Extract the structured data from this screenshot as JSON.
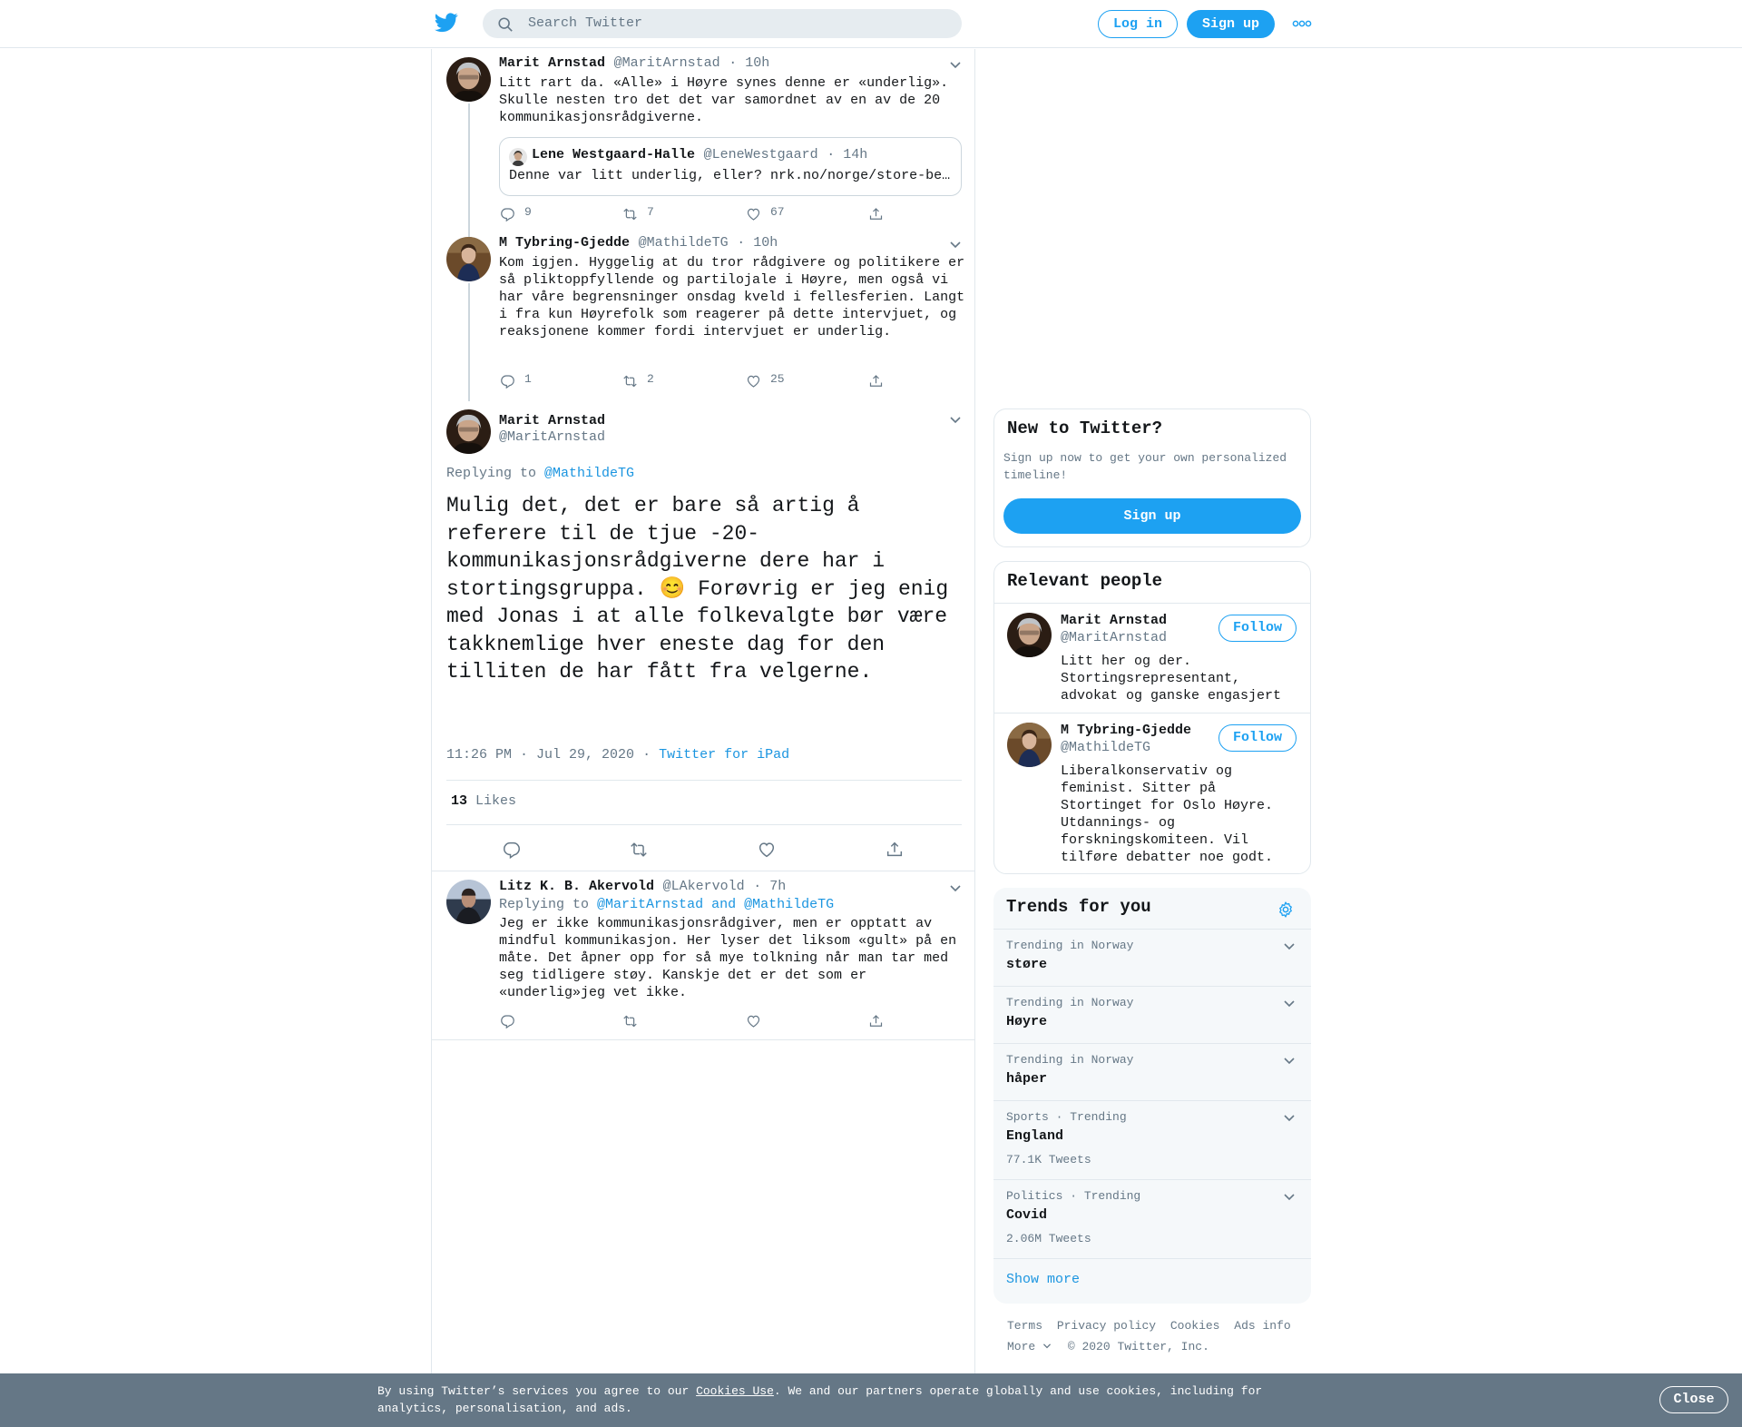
{
  "nav": {
    "search_placeholder": "Search Twitter",
    "login_label": "Log in",
    "signup_label": "Sign up",
    "icons": [
      "twitter-bird-icon",
      "search-icon",
      "more-icon"
    ],
    "accent_color": "#1da1f2"
  },
  "thread": [
    {
      "name": "Marit Arnstad",
      "handle": "@MaritArnstad",
      "time": "· 10h",
      "text": "Litt rart da. «Alle» i Høyre synes denne er «underlig». Skulle nesten tro det det var samordnet av en av de 20 kommunikasjonsrådgiverne.",
      "quote": {
        "name": "Lene Westgaard-Halle",
        "handle": "@LeneWestgaard",
        "time": "· 14h",
        "text": "Denne var litt underlig, eller? nrk.no/norge/store-be…"
      },
      "replies": "9",
      "retweets": "7",
      "likes": "67"
    },
    {
      "name": "M Tybring-Gjedde",
      "handle": "@MathildeTG",
      "time": "· 10h",
      "text": "Kom igjen. Hyggelig at du tror rådgivere og politikere er så pliktoppfyllende og partilojale i Høyre, men også vi har våre begrensninger onsdag kveld i fellesferien. Langt i fra kun Høyrefolk som reagerer på dette intervjuet, og reaksjonene kommer fordi intervjuet er underlig.",
      "replies": "1",
      "retweets": "2",
      "likes": "25"
    }
  ],
  "focused": {
    "name": "Marit Arnstad",
    "handle": "@MaritArnstad",
    "replying_prefix": "Replying to",
    "replying_to": "@MathildeTG",
    "text_part1": "Mulig det, det er bare så artig å referere til de tjue -20-kommunikasjonsrådgiverne dere har i stortingsgruppa.",
    "emoji": "😊",
    "text_part2": "Forøvrig er jeg enig med Jonas i at alle folkevalgte bør være takknemlige hver eneste dag for den tilliten de har fått fra velgerne.",
    "timestamp": "11:26 PM · Jul 29, 2020",
    "sep": "·",
    "source": "Twitter for iPad",
    "likes_count": "13",
    "likes_label": "Likes"
  },
  "reply": {
    "name": "Litz K. B. Akervold",
    "handle": "@LAkervold",
    "time": "· 7h",
    "replying_prefix": "Replying to",
    "replying_to": "@MaritArnstad and @MathildeTG",
    "text": "Jeg er ikke kommunikasjonsrådgiver, men er opptatt av mindful kommunikasjon. Her lyser det liksom «gult» på en måte. Det åpner opp for så mye tolkning når man tar med seg tidligere støy. Kanskje det er det som er «underlig»jeg vet ikke."
  },
  "new_to_twitter": {
    "title": "New to Twitter?",
    "text": "Sign up now to get your own personalized timeline!",
    "button": "Sign up"
  },
  "relevant": {
    "title": "Relevant people",
    "people": [
      {
        "name": "Marit Arnstad",
        "handle": "@MaritArnstad",
        "bio": "Litt her og der. Stortingsrepresentant, advokat og ganske engasjert",
        "follow": "Follow"
      },
      {
        "name": "M Tybring-Gjedde",
        "handle": "@MathildeTG",
        "bio": "Liberalkonservativ og feminist. Sitter på Stortinget for Oslo Høyre. Utdannings- og forskningskomiteen. Vil tilføre debatter noe godt.",
        "follow": "Follow"
      }
    ]
  },
  "trends": {
    "title": "Trends for you",
    "items": [
      {
        "category": "Trending in Norway",
        "name": "støre",
        "count": ""
      },
      {
        "category": "Trending in Norway",
        "name": "Høyre",
        "count": ""
      },
      {
        "category": "Trending in Norway",
        "name": "håper",
        "count": ""
      },
      {
        "category": "Sports · Trending",
        "name": "England",
        "count": "77.1K Tweets"
      },
      {
        "category": "Politics · Trending",
        "name": "Covid",
        "count": "2.06M Tweets"
      }
    ],
    "show_more": "Show more"
  },
  "footer": {
    "links": [
      "Terms",
      "Privacy policy",
      "Cookies",
      "Ads info"
    ],
    "more": "More",
    "copyright": "© 2020 Twitter, Inc."
  },
  "cookie": {
    "text_before": "By using Twitter’s services you agree to our ",
    "link": "Cookies Use",
    "text_after": ". We and our partners operate globally and use cookies, including for analytics, personalisation, and ads.",
    "close": "Close"
  }
}
